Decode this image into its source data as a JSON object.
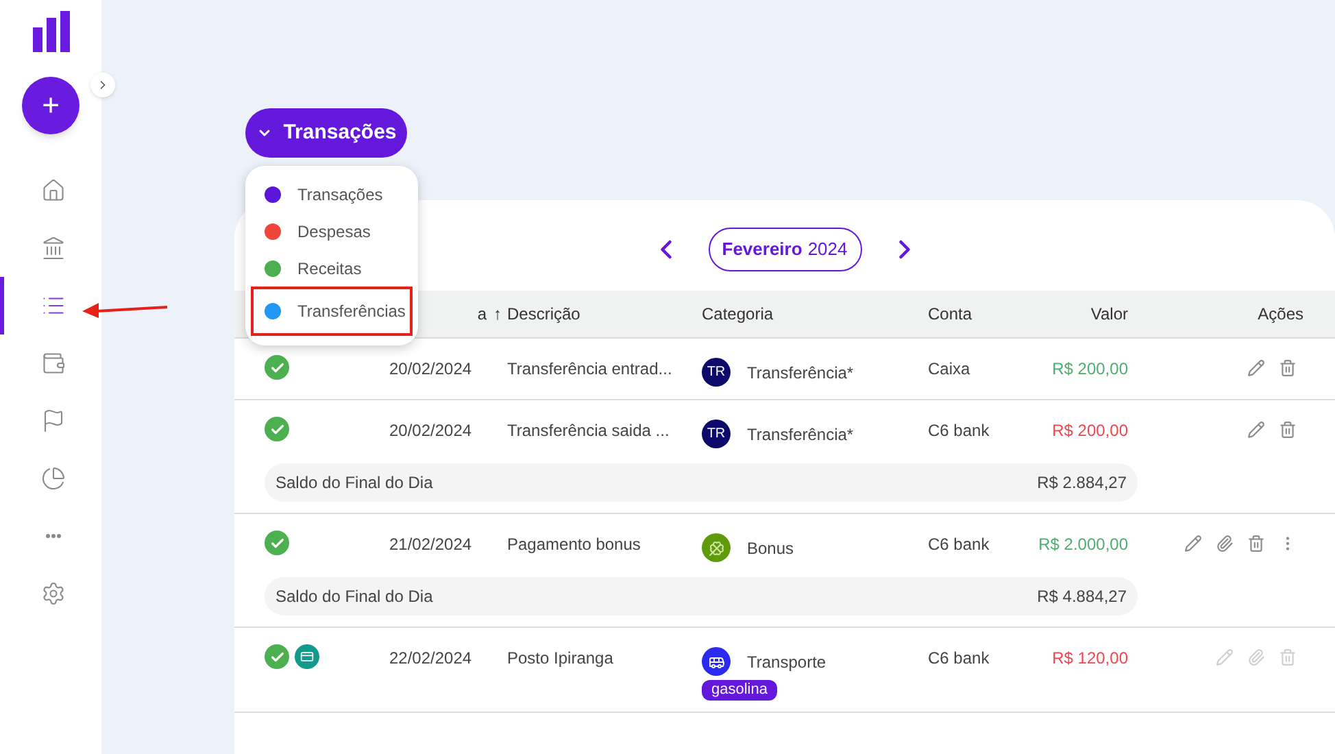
{
  "sidebar": {
    "add_button": "+",
    "items": [
      {
        "kind": "home",
        "selected": false
      },
      {
        "kind": "bank",
        "selected": false
      },
      {
        "kind": "list",
        "selected": true
      },
      {
        "kind": "wallet",
        "selected": false
      },
      {
        "kind": "flag",
        "selected": false
      },
      {
        "kind": "pie",
        "selected": false
      },
      {
        "kind": "more",
        "selected": false
      },
      {
        "kind": "settings",
        "selected": false
      }
    ]
  },
  "view_selector": {
    "label": "Transações",
    "menu": [
      {
        "label": "Transações",
        "color": "#5b16d9",
        "highlighted": false
      },
      {
        "label": "Despesas",
        "color": "#f0453a",
        "highlighted": false
      },
      {
        "label": "Receitas",
        "color": "#4caf50",
        "highlighted": false
      },
      {
        "label": "Transferências",
        "color": "#2196f3",
        "highlighted": true
      }
    ]
  },
  "month_nav": {
    "month": "Fevereiro",
    "year": "2024"
  },
  "table": {
    "columns": [
      {
        "label": "a",
        "sort_arrow": "↑"
      },
      {
        "label": "Descrição"
      },
      {
        "label": "Categoria"
      },
      {
        "label": "Conta"
      },
      {
        "label": "Valor"
      },
      {
        "label": "Ações"
      }
    ],
    "rows": [
      {
        "status": [
          {
            "kind": "confirmed"
          }
        ],
        "date": "20/02/2024",
        "description": "Transferência entrad...",
        "category": {
          "kind": "initials",
          "initials": "TR",
          "color": "#0d0a6b",
          "name": "Transferência*"
        },
        "account": "Caixa",
        "value": "R$ 200,00",
        "kind": "income",
        "actions": [
          {
            "kind": "edit"
          },
          {
            "kind": "delete"
          }
        ],
        "actions_disabled": false
      },
      {
        "status": [
          {
            "kind": "confirmed"
          }
        ],
        "date": "20/02/2024",
        "description": "Transferência saida ...",
        "category": {
          "kind": "initials",
          "initials": "TR",
          "color": "#0d0a6b",
          "name": "Transferência*"
        },
        "account": "C6 bank",
        "value": "R$ 200,00",
        "kind": "expense",
        "actions": [
          {
            "kind": "edit"
          },
          {
            "kind": "delete"
          }
        ],
        "actions_disabled": false,
        "day_balance": {
          "label": "Saldo do Final do Dia",
          "value": "R$ 2.884,27"
        }
      },
      {
        "status": [
          {
            "kind": "confirmed"
          }
        ],
        "date": "21/02/2024",
        "description": "Pagamento bonus",
        "category": {
          "kind": "clover",
          "color": "#5f9a0a",
          "name": "Bonus"
        },
        "account": "C6 bank",
        "value": "R$ 2.000,00",
        "kind": "income",
        "actions": [
          {
            "kind": "edit"
          },
          {
            "kind": "attach"
          },
          {
            "kind": "delete"
          },
          {
            "kind": "more"
          }
        ],
        "actions_disabled": false,
        "day_balance": {
          "label": "Saldo do Final do Dia",
          "value": "R$ 4.884,27"
        }
      },
      {
        "status": [
          {
            "kind": "confirmed"
          },
          {
            "kind": "card"
          }
        ],
        "date": "22/02/2024",
        "description": "Posto Ipiranga",
        "category": {
          "kind": "bus",
          "color": "#2a2af0",
          "name": "Transporte"
        },
        "tag": "gasolina",
        "account": "C6 bank",
        "value": "R$ 120,00",
        "kind": "expense",
        "actions": [
          {
            "kind": "edit"
          },
          {
            "kind": "attach"
          },
          {
            "kind": "delete"
          }
        ],
        "actions_disabled": true
      }
    ]
  }
}
